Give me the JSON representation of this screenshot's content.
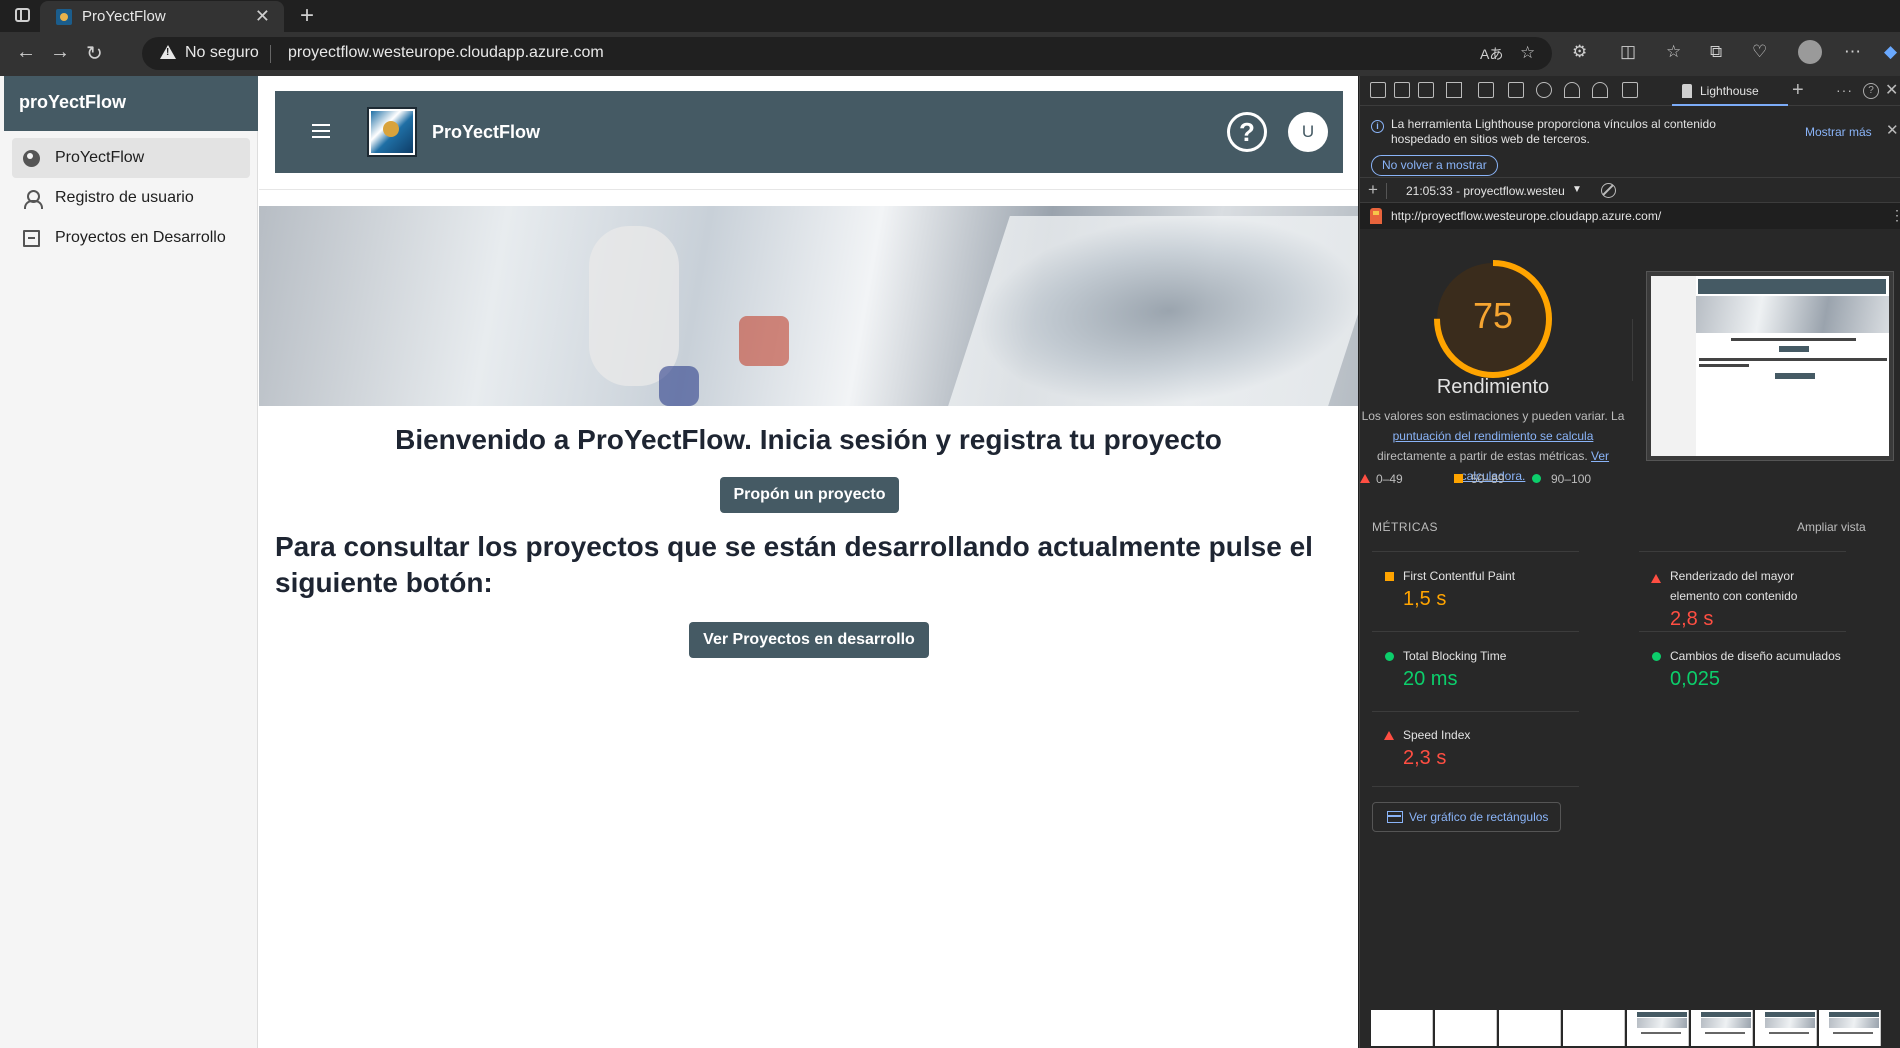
{
  "browser": {
    "tab_title": "ProYectFlow",
    "security_label": "No seguro",
    "url": "proyectflow.westeurope.cloudapp.azure.com"
  },
  "sidebar": {
    "title": "proYectFlow",
    "items": [
      {
        "label": "ProYectFlow",
        "icon": "globe-icon",
        "active": true
      },
      {
        "label": "Registro de usuario",
        "icon": "user-icon",
        "active": false
      },
      {
        "label": "Proyectos en Desarrollo",
        "icon": "archive-icon",
        "active": false
      }
    ]
  },
  "header": {
    "brand": "ProYectFlow",
    "help_symbol": "?",
    "avatar_initial": "U"
  },
  "main": {
    "welcome": "Bienvenido a ProYectFlow. Inicia sesión y registra tu proyecto",
    "propose_button": "Propón un proyecto",
    "consult_text": "Para consultar los proyectos que se están desarrollando actualmente pulse el siguiente botón:",
    "view_button": "Ver Proyectos en desarrollo"
  },
  "devtools": {
    "active_tab": "Lighthouse",
    "info_text": "La herramienta Lighthouse proporciona vínculos al contenido hospedado en sitios web de terceros.",
    "show_more": "Mostrar más",
    "dont_show": "No volver a mostrar",
    "report_selector": "21:05:33 - proyectflow.westeu",
    "report_url": "http://proyectflow.westeurope.cloudapp.azure.com/",
    "score": "75",
    "score_fraction": 0.75,
    "category": "Rendimiento",
    "desc_1": "Los valores son estimaciones y pueden variar. La",
    "desc_link_1": "puntuación del rendimiento se calcula",
    "desc_2": " directamente a partir de estas métricas. ",
    "desc_link_2": "Ver calculadora.",
    "legend": {
      "fail": "0–49",
      "average": "50–89",
      "pass": "90–100"
    },
    "metrics_header": "MÉTRICAS",
    "expand_view": "Ampliar vista",
    "metrics": [
      {
        "name": "First Contentful Paint",
        "value": "1,5 s",
        "status": "average"
      },
      {
        "name": "Renderizado del mayor elemento con contenido",
        "value": "2,8 s",
        "status": "fail"
      },
      {
        "name": "Total Blocking Time",
        "value": "20 ms",
        "status": "pass"
      },
      {
        "name": "Cambios de diseño acumulados",
        "value": "0,025",
        "status": "pass"
      },
      {
        "name": "Speed Index",
        "value": "2,3 s",
        "status": "fail"
      }
    ],
    "treemap_button": "Ver gráfico de rectángulos",
    "colors": {
      "fail": "#ff4e42",
      "average": "#ffa400",
      "pass": "#0cce6b"
    }
  }
}
